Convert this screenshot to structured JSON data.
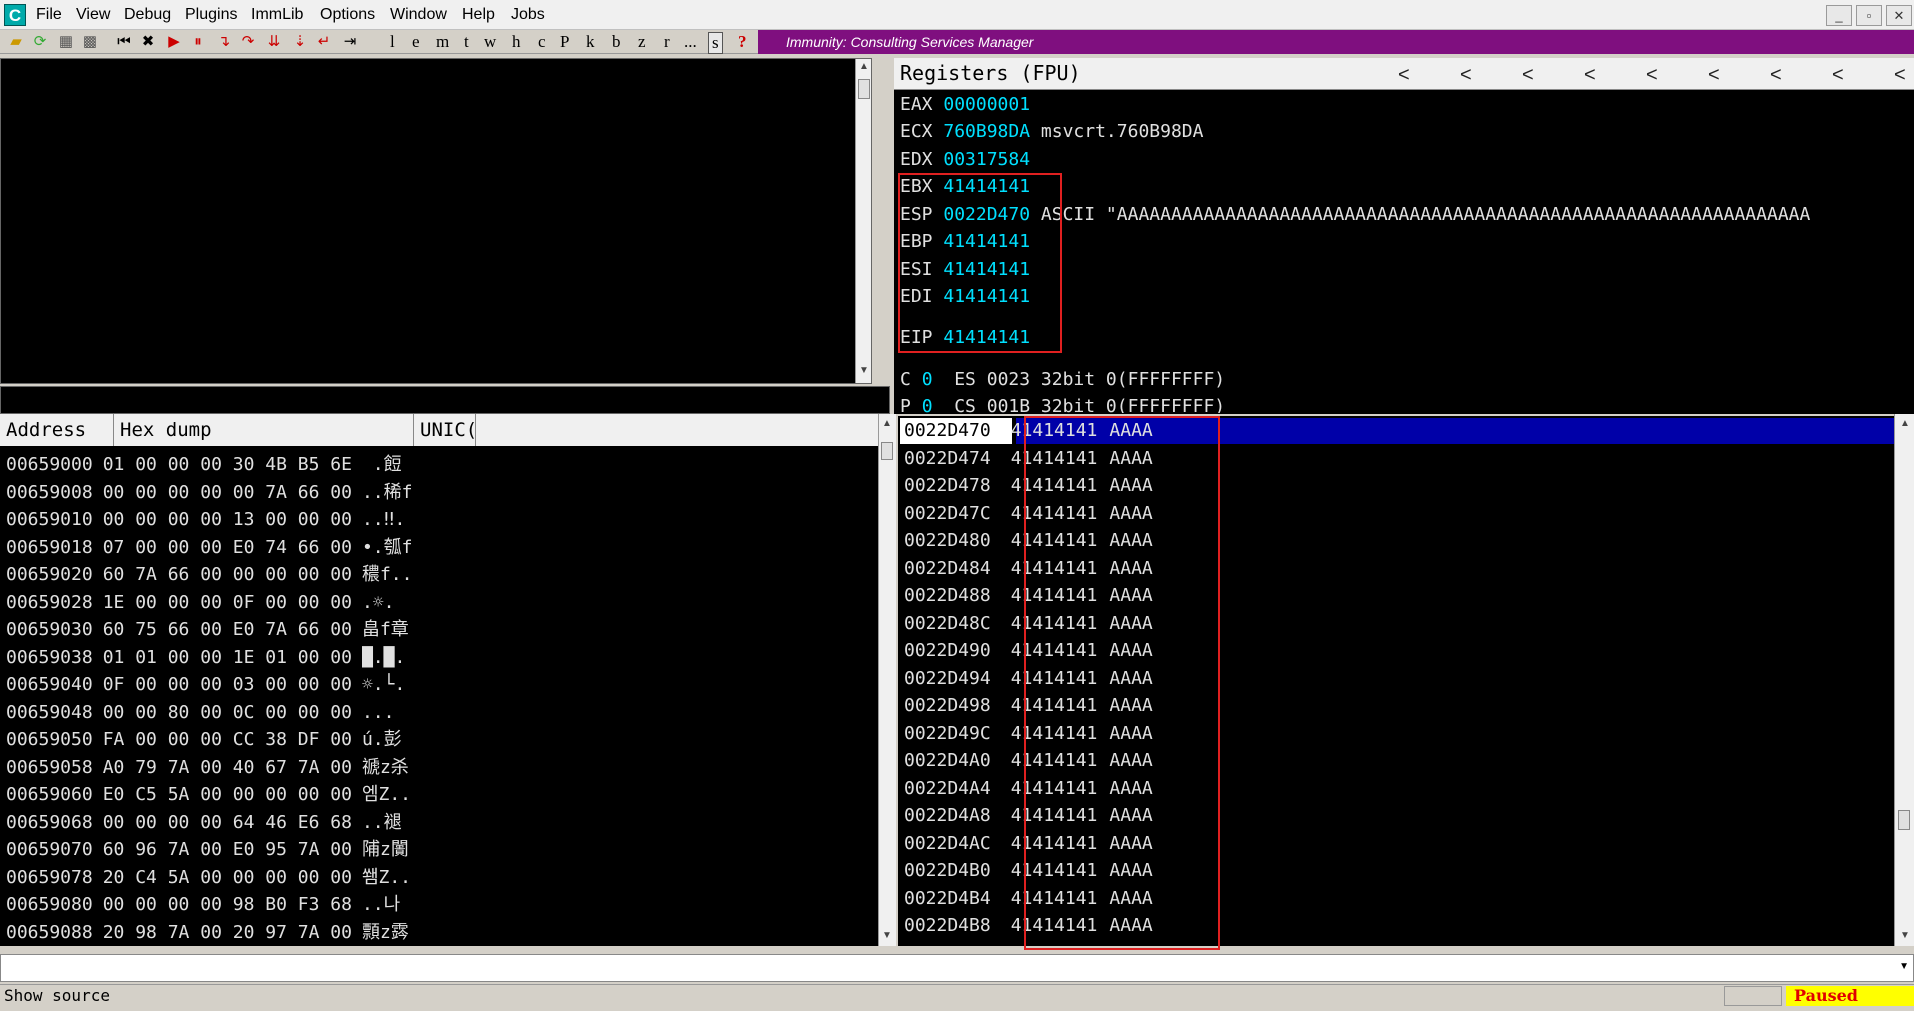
{
  "app": {
    "icon_letter": "C"
  },
  "menu": [
    "File",
    "View",
    "Debug",
    "Plugins",
    "ImmLib",
    "Options",
    "Window",
    "Help",
    "Jobs"
  ],
  "toolbar": {
    "letters": [
      "l",
      "e",
      "m",
      "t",
      "w",
      "h",
      "c",
      "P",
      "k",
      "b",
      "z",
      "r",
      "...",
      "s",
      "?"
    ],
    "banner": "Immunity: Consulting Services Manager"
  },
  "registers": {
    "title": "Registers (FPU)",
    "rows": [
      {
        "name": "EAX",
        "value": "00000001",
        "comment": ""
      },
      {
        "name": "ECX",
        "value": "760B98DA",
        "comment": "msvcrt.760B98DA"
      },
      {
        "name": "EDX",
        "value": "00317584",
        "comment": ""
      },
      {
        "name": "EBX",
        "value": "41414141",
        "comment": ""
      },
      {
        "name": "ESP",
        "value": "0022D470",
        "comment": "ASCII \"AAAAAAAAAAAAAAAAAAAAAAAAAAAAAAAAAAAAAAAAAAAAAAAAAAAAAAAAAAAAAAAA"
      },
      {
        "name": "EBP",
        "value": "41414141",
        "comment": ""
      },
      {
        "name": "ESI",
        "value": "41414141",
        "comment": ""
      },
      {
        "name": "EDI",
        "value": "41414141",
        "comment": ""
      },
      {
        "name": "EIP",
        "value": "41414141",
        "comment": ""
      }
    ],
    "flags": [
      {
        "flag": "C",
        "val": "0",
        "seg": "ES 0023 32bit 0(FFFFFFFF)"
      },
      {
        "flag": "P",
        "val": "0",
        "seg": "CS 001B 32bit 0(FFFFFFFF)"
      }
    ]
  },
  "dump": {
    "headers": [
      "Address",
      "Hex dump",
      "UNIC("
    ],
    "rows": [
      {
        "addr": "00659000",
        "hex": "01 00 00 00 30 4B B5 6E",
        "text": " .餖"
      },
      {
        "addr": "00659008",
        "hex": "00 00 00 00 00 7A 66 00",
        "text": "..稀f"
      },
      {
        "addr": "00659010",
        "hex": "00 00 00 00 13 00 00 00",
        "text": "..‼."
      },
      {
        "addr": "00659018",
        "hex": "07 00 00 00 E0 74 66 00",
        "text": "•.瓠f"
      },
      {
        "addr": "00659020",
        "hex": "60 7A 66 00 00 00 00 00",
        "text": "穠f.."
      },
      {
        "addr": "00659028",
        "hex": "1E 00 00 00 0F 00 00 00",
        "text": ".☼."
      },
      {
        "addr": "00659030",
        "hex": "60 75 66 00 E0 7A 66 00",
        "text": "畠f章"
      },
      {
        "addr": "00659038",
        "hex": "01 01 00 00 1E 01 00 00",
        "text": "█.█."
      },
      {
        "addr": "00659040",
        "hex": "0F 00 00 00 03 00 00 00",
        "text": "☼.└."
      },
      {
        "addr": "00659048",
        "hex": "00 00 80 00 0C 00 00 00",
        "text": "..."
      },
      {
        "addr": "00659050",
        "hex": "FA 00 00 00 CC 38 DF 00",
        "text": "ú.彭"
      },
      {
        "addr": "00659058",
        "hex": "A0 79 7A 00 40 67 7A 00",
        "text": "禠z杀"
      },
      {
        "addr": "00659060",
        "hex": "E0 C5 5A 00 00 00 00 00",
        "text": "엠Z.."
      },
      {
        "addr": "00659068",
        "hex": "00 00 00 00 64 46 E6 68",
        "text": "..褪"
      },
      {
        "addr": "00659070",
        "hex": "60 96 7A 00 E0 95 7A 00",
        "text": "陠z闠"
      },
      {
        "addr": "00659078",
        "hex": "20 C4 5A 00 00 00 00 00",
        "text": "쐠Z.."
      },
      {
        "addr": "00659080",
        "hex": "00 00 00 00 98 B0 F3 68",
        "text": "..나"
      },
      {
        "addr": "00659088",
        "hex": "20 98 7A 00 20 97 7A 00",
        "text": "顠z霠"
      }
    ]
  },
  "stack": {
    "rows": [
      {
        "addr": "0022D470",
        "val": "41414141",
        "text": "AAAA"
      },
      {
        "addr": "0022D474",
        "val": "41414141",
        "text": "AAAA"
      },
      {
        "addr": "0022D478",
        "val": "41414141",
        "text": "AAAA"
      },
      {
        "addr": "0022D47C",
        "val": "41414141",
        "text": "AAAA"
      },
      {
        "addr": "0022D480",
        "val": "41414141",
        "text": "AAAA"
      },
      {
        "addr": "0022D484",
        "val": "41414141",
        "text": "AAAA"
      },
      {
        "addr": "0022D488",
        "val": "41414141",
        "text": "AAAA"
      },
      {
        "addr": "0022D48C",
        "val": "41414141",
        "text": "AAAA"
      },
      {
        "addr": "0022D490",
        "val": "41414141",
        "text": "AAAA"
      },
      {
        "addr": "0022D494",
        "val": "41414141",
        "text": "AAAA"
      },
      {
        "addr": "0022D498",
        "val": "41414141",
        "text": "AAAA"
      },
      {
        "addr": "0022D49C",
        "val": "41414141",
        "text": "AAAA"
      },
      {
        "addr": "0022D4A0",
        "val": "41414141",
        "text": "AAAA"
      },
      {
        "addr": "0022D4A4",
        "val": "41414141",
        "text": "AAAA"
      },
      {
        "addr": "0022D4A8",
        "val": "41414141",
        "text": "AAAA"
      },
      {
        "addr": "0022D4AC",
        "val": "41414141",
        "text": "AAAA"
      },
      {
        "addr": "0022D4B0",
        "val": "41414141",
        "text": "AAAA"
      },
      {
        "addr": "0022D4B4",
        "val": "41414141",
        "text": "AAAA"
      },
      {
        "addr": "0022D4B8",
        "val": "41414141",
        "text": "AAAA"
      }
    ]
  },
  "status": {
    "text": "Show source",
    "state": "Paused"
  },
  "colors": {
    "banner": "#7f0f7f",
    "register_value": "#00e0ff",
    "highlight": "#e02020",
    "selection": "#0000a8",
    "paused_bg": "#ffff00"
  }
}
